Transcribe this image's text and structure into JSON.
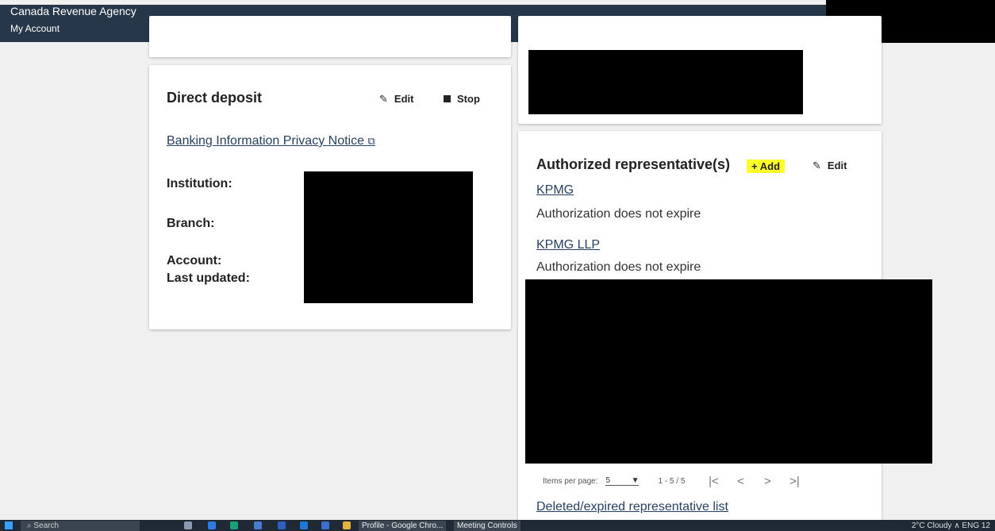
{
  "header": {
    "agency": "Canada Revenue Agency",
    "section": "My Account"
  },
  "direct_deposit": {
    "title": "Direct deposit",
    "edit_label": "Edit",
    "stop_label": "Stop",
    "privacy_link": "Banking Information Privacy Notice",
    "fields": {
      "institution": "Institution:",
      "branch": "Branch:",
      "account": "Account:",
      "last_updated": "Last updated:"
    }
  },
  "authorized_reps": {
    "title": "Authorized representative(s)",
    "add_label": "Add",
    "edit_label": "Edit",
    "highlight_color": "#ffff2a",
    "items": [
      {
        "name": "KPMG",
        "status": "Authorization does not expire"
      },
      {
        "name": "KPMG LLP",
        "status": "Authorization does not expire"
      }
    ],
    "paginator": {
      "items_per_page_label": "Items per page:",
      "items_per_page_value": "5",
      "range": "1 - 5 / 5"
    },
    "deleted_link": "Deleted/expired representative list"
  },
  "taskbar": {
    "search": "Search",
    "apps": [
      "Profile - Google Chro...",
      "Meeting Controls"
    ],
    "tray": "2°C  Cloudy  ∧  ENG  12"
  },
  "colors": {
    "appbar": "#26374a",
    "link": "#284162",
    "redaction": "#000000"
  }
}
